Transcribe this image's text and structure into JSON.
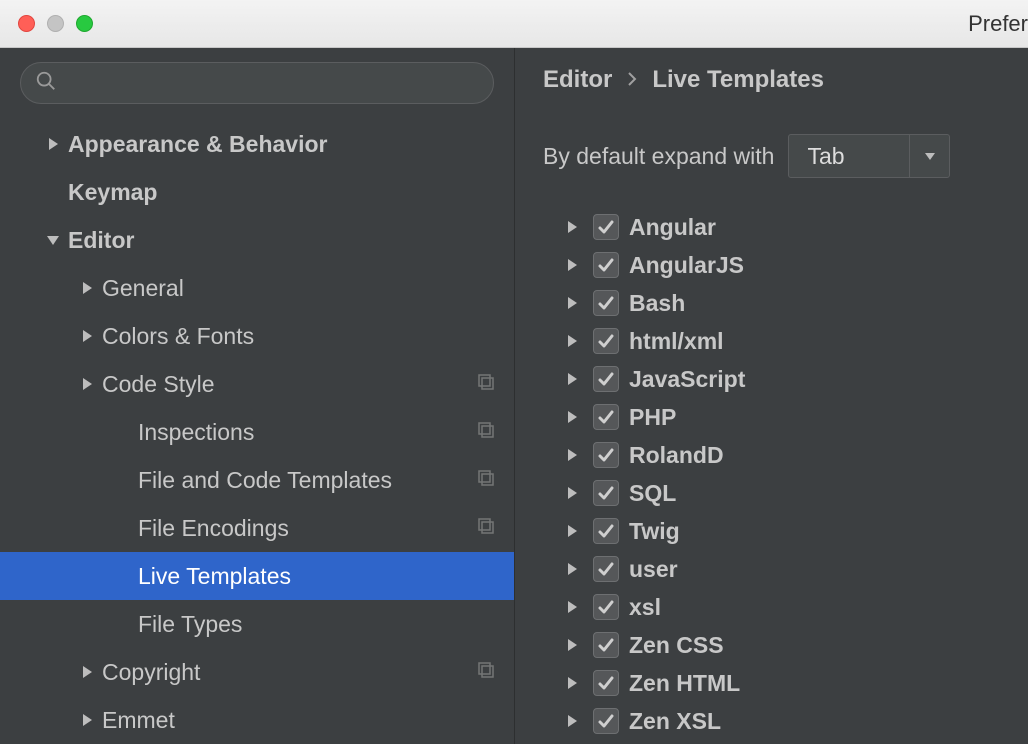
{
  "window": {
    "title": "Prefer"
  },
  "sidebar": {
    "search_placeholder": "",
    "items": [
      {
        "label": "Appearance & Behavior",
        "level": 0,
        "bold": true,
        "arrow": "right",
        "badge": false,
        "selected": false
      },
      {
        "label": "Keymap",
        "level": 0,
        "bold": true,
        "arrow": "none",
        "badge": false,
        "selected": false
      },
      {
        "label": "Editor",
        "level": 0,
        "bold": true,
        "arrow": "down",
        "badge": false,
        "selected": false
      },
      {
        "label": "General",
        "level": 1,
        "bold": false,
        "arrow": "right",
        "badge": false,
        "selected": false
      },
      {
        "label": "Colors & Fonts",
        "level": 1,
        "bold": false,
        "arrow": "right",
        "badge": false,
        "selected": false
      },
      {
        "label": "Code Style",
        "level": 1,
        "bold": false,
        "arrow": "right",
        "badge": true,
        "selected": false
      },
      {
        "label": "Inspections",
        "level": 2,
        "bold": false,
        "arrow": "none",
        "badge": true,
        "selected": false
      },
      {
        "label": "File and Code Templates",
        "level": 2,
        "bold": false,
        "arrow": "none",
        "badge": true,
        "selected": false
      },
      {
        "label": "File Encodings",
        "level": 2,
        "bold": false,
        "arrow": "none",
        "badge": true,
        "selected": false
      },
      {
        "label": "Live Templates",
        "level": 2,
        "bold": false,
        "arrow": "none",
        "badge": false,
        "selected": true
      },
      {
        "label": "File Types",
        "level": 2,
        "bold": false,
        "arrow": "none",
        "badge": false,
        "selected": false
      },
      {
        "label": "Copyright",
        "level": 1,
        "bold": false,
        "arrow": "right",
        "badge": true,
        "selected": false
      },
      {
        "label": "Emmet",
        "level": 1,
        "bold": false,
        "arrow": "right",
        "badge": false,
        "selected": false
      }
    ]
  },
  "main": {
    "breadcrumb": {
      "a": "Editor",
      "b": "Live Templates"
    },
    "expand_label": "By default expand with",
    "expand_value": "Tab",
    "groups": [
      {
        "label": "Angular",
        "checked": true
      },
      {
        "label": "AngularJS",
        "checked": true
      },
      {
        "label": "Bash",
        "checked": true
      },
      {
        "label": "html/xml",
        "checked": true
      },
      {
        "label": "JavaScript",
        "checked": true
      },
      {
        "label": "PHP",
        "checked": true
      },
      {
        "label": "RolandD",
        "checked": true
      },
      {
        "label": "SQL",
        "checked": true
      },
      {
        "label": "Twig",
        "checked": true
      },
      {
        "label": "user",
        "checked": true
      },
      {
        "label": "xsl",
        "checked": true
      },
      {
        "label": "Zen CSS",
        "checked": true
      },
      {
        "label": "Zen HTML",
        "checked": true
      },
      {
        "label": "Zen XSL",
        "checked": true
      }
    ]
  }
}
